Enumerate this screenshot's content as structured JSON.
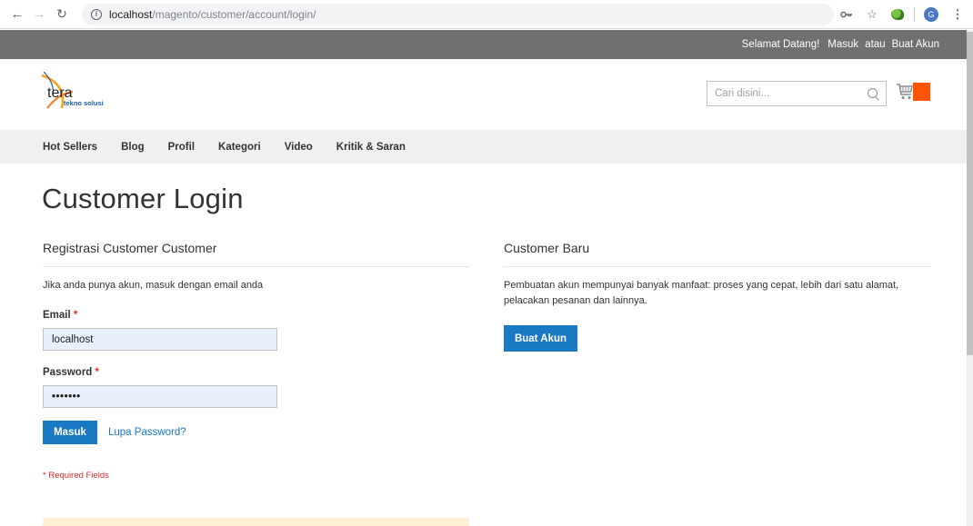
{
  "browser": {
    "url_host": "localhost",
    "url_path": "/magento/customer/account/login/",
    "profile_initial": "G"
  },
  "header": {
    "welcome": "Selamat Datang!",
    "sign_in": "Masuk",
    "or": "atau",
    "create_account": "Buat Akun"
  },
  "logo": {
    "name": "tera",
    "tagline": "tekno solusi"
  },
  "search": {
    "placeholder": "Cari disini..."
  },
  "nav": {
    "items": [
      "Hot Sellers",
      "Blog",
      "Profil",
      "Kategori",
      "Video",
      "Kritik & Saran"
    ]
  },
  "page": {
    "title": "Customer Login"
  },
  "login": {
    "title": "Registrasi Customer Customer",
    "intro": "Jika anda punya akun, masuk dengan email anda",
    "email_label": "Email",
    "email_value": "localhost",
    "password_label": "Password",
    "password_value": "•••••••",
    "required_mark": "*",
    "submit_label": "Masuk",
    "forgot_label": "Lupa Password?",
    "required_note": "* Required Fields"
  },
  "new_customer": {
    "title": "Customer Baru",
    "text": "Pembuatan akun mempunyai banyak manfaat: proses yang cepat, lebih dari satu alamat, pelacakan pesanan dan lainnya.",
    "button_label": "Buat Akun"
  },
  "colors": {
    "primary": "#1979c3",
    "header_bg": "#6e716e",
    "cart_accent": "#ff5501",
    "required": "#e02b27",
    "autofill_bg": "#e8f0fe"
  }
}
